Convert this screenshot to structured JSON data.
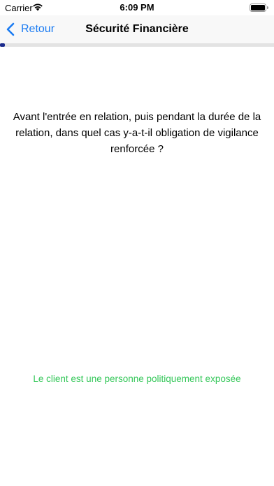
{
  "status_bar": {
    "carrier": "Carrier",
    "time": "6:09 PM"
  },
  "nav": {
    "back_label": "Retour",
    "title": "Sécurité Financière"
  },
  "progress": {
    "fraction": 0.018
  },
  "question": {
    "text": "Avant l'entrée en relation, puis pendant la durée de la relation, dans quel cas y-a-t-il obligation de vigilance renforcée ?"
  },
  "answer": {
    "text": "Le client est une personne politiquement exposée"
  },
  "colors": {
    "accent": "#1a7bf2",
    "progress": "#1a2a8c",
    "answer": "#34c759"
  }
}
